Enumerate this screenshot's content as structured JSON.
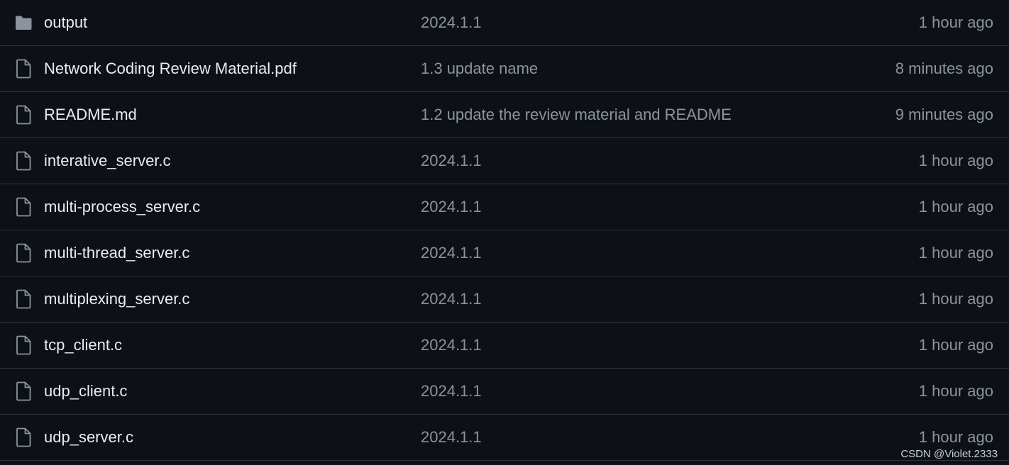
{
  "colors": {
    "background": "#0d1117",
    "row_divider": "#30363d",
    "primary_text": "#e6edf3",
    "secondary_text": "#8b949e",
    "icon": "#8b949e"
  },
  "files": [
    {
      "icon": "folder-icon",
      "name": "output",
      "commit": "2024.1.1",
      "time": "1 hour ago"
    },
    {
      "icon": "file-icon",
      "name": "Network Coding Review Material.pdf",
      "commit": "1.3 update name",
      "time": "8 minutes ago"
    },
    {
      "icon": "file-icon",
      "name": "README.md",
      "commit": "1.2 update the review material and README",
      "time": "9 minutes ago"
    },
    {
      "icon": "file-icon",
      "name": "interative_server.c",
      "commit": "2024.1.1",
      "time": "1 hour ago"
    },
    {
      "icon": "file-icon",
      "name": "multi-process_server.c",
      "commit": "2024.1.1",
      "time": "1 hour ago"
    },
    {
      "icon": "file-icon",
      "name": "multi-thread_server.c",
      "commit": "2024.1.1",
      "time": "1 hour ago"
    },
    {
      "icon": "file-icon",
      "name": "multiplexing_server.c",
      "commit": "2024.1.1",
      "time": "1 hour ago"
    },
    {
      "icon": "file-icon",
      "name": "tcp_client.c",
      "commit": "2024.1.1",
      "time": "1 hour ago"
    },
    {
      "icon": "file-icon",
      "name": "udp_client.c",
      "commit": "2024.1.1",
      "time": "1 hour ago"
    },
    {
      "icon": "file-icon",
      "name": "udp_server.c",
      "commit": "2024.1.1",
      "time": "1 hour ago"
    }
  ],
  "watermark": "CSDN @Violet.2333"
}
